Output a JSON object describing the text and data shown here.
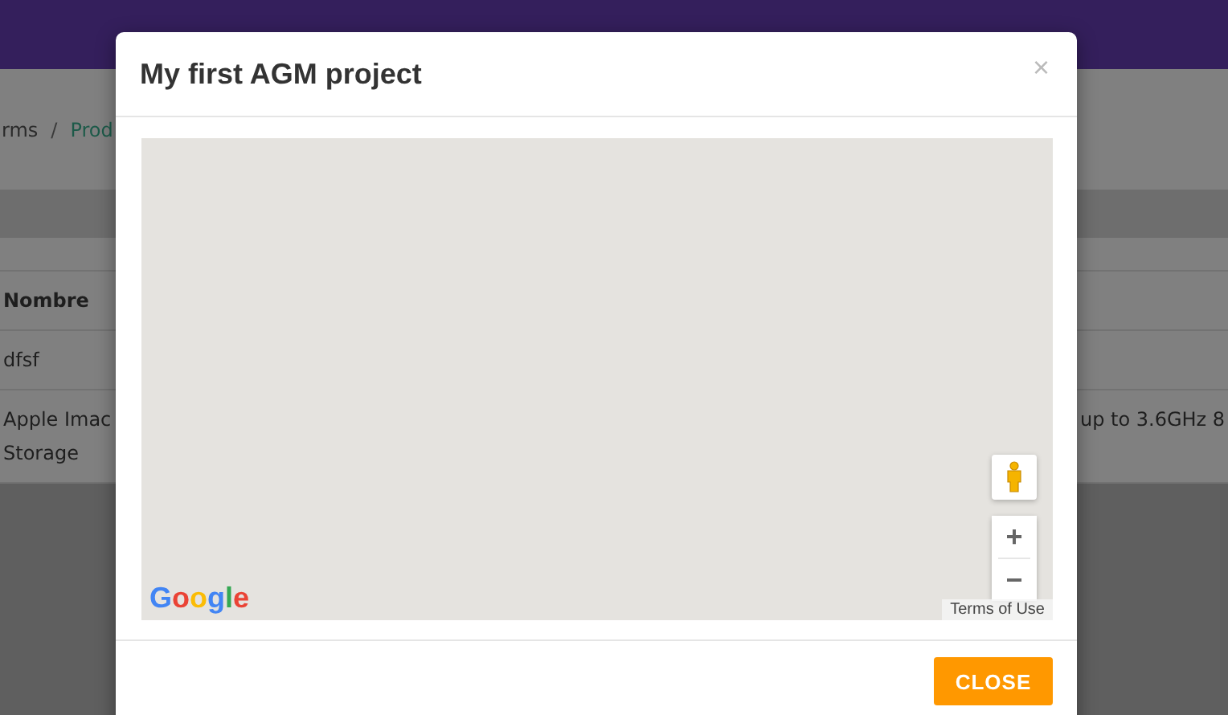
{
  "breadcrumb": {
    "items": [
      {
        "label": "rms",
        "kind": "text"
      },
      {
        "label": "Prod",
        "kind": "link"
      }
    ],
    "separator": "/"
  },
  "table": {
    "columns": [
      "Nombre"
    ],
    "rows": [
      {
        "cells": [
          "dfsf"
        ]
      },
      {
        "cells": [
          "Apple Imac\nStorage"
        ],
        "column_2": "up to 3.6GHz 8"
      }
    ]
  },
  "modal": {
    "title": "My first AGM project",
    "close_glyph": "×",
    "map": {
      "logo": "Google",
      "terms": "Terms of Use",
      "zoom_in": "+",
      "zoom_out": "−"
    },
    "buttons": [
      "CLOSE"
    ]
  }
}
